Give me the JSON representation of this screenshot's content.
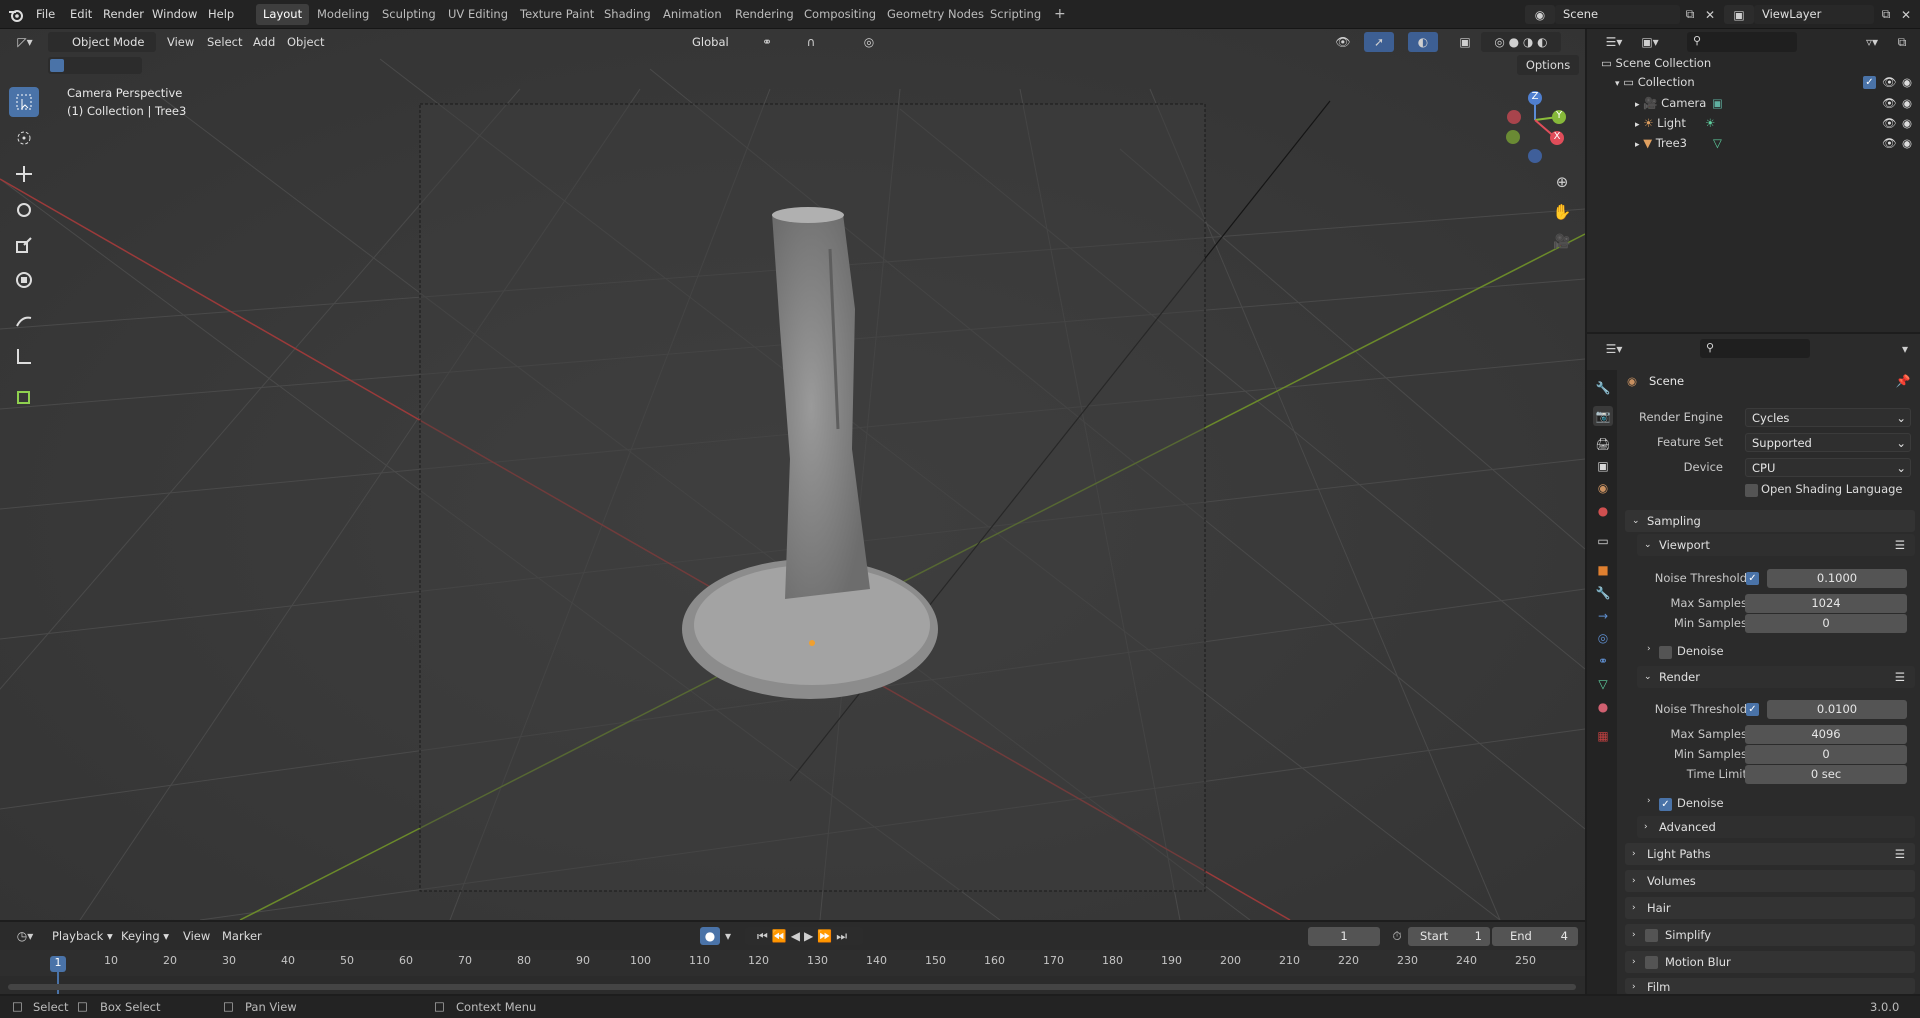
{
  "topbar": {
    "menus": [
      "File",
      "Edit",
      "Render",
      "Window",
      "Help"
    ],
    "workspaces": [
      "Layout",
      "Modeling",
      "Sculpting",
      "UV Editing",
      "Texture Paint",
      "Shading",
      "Animation",
      "Rendering",
      "Compositing",
      "Geometry Nodes",
      "Scripting"
    ],
    "active_workspace": "Layout",
    "add_tab": "+",
    "scene": "Scene",
    "view_layer": "ViewLayer"
  },
  "viewport": {
    "mode": "Object Mode",
    "menus": [
      "View",
      "Select",
      "Add",
      "Object"
    ],
    "orientation": "Global",
    "options": "Options",
    "overlay_line1": "Camera Perspective",
    "overlay_line2": "(1) Collection | Tree3",
    "gizmo": {
      "z": "Z",
      "y": "Y",
      "x": "X"
    }
  },
  "outliner": {
    "root": "Scene Collection",
    "collection": "Collection",
    "items": [
      "Camera",
      "Light",
      "Tree3"
    ]
  },
  "properties": {
    "context": "Scene",
    "render_engine_label": "Render Engine",
    "render_engine": "Cycles",
    "feature_set_label": "Feature Set",
    "feature_set": "Supported",
    "device_label": "Device",
    "device": "CPU",
    "osl_label": "Open Shading Language",
    "sampling": "Sampling",
    "viewport": {
      "title": "Viewport",
      "noise_label": "Noise Threshold",
      "noise": "0.1000",
      "max_label": "Max Samples",
      "max": "1024",
      "min_label": "Min Samples",
      "min": "0",
      "denoise": "Denoise"
    },
    "render": {
      "title": "Render",
      "noise_label": "Noise Threshold",
      "noise": "0.0100",
      "max_label": "Max Samples",
      "max": "4096",
      "min_label": "Min Samples",
      "min": "0",
      "time_label": "Time Limit",
      "time": "0 sec",
      "denoise": "Denoise"
    },
    "advanced": "Advanced",
    "panels": [
      "Light Paths",
      "Volumes",
      "Hair",
      "Simplify",
      "Motion Blur",
      "Film"
    ]
  },
  "timeline": {
    "menus": [
      "Playback",
      "Keying",
      "View",
      "Marker"
    ],
    "current_frame": "1",
    "start_label": "Start",
    "start": "1",
    "end_label": "End",
    "end": "4",
    "ticks": [
      "1",
      "10",
      "20",
      "30",
      "40",
      "50",
      "60",
      "70",
      "80",
      "90",
      "100",
      "110",
      "120",
      "130",
      "140",
      "150",
      "160",
      "170",
      "180",
      "190",
      "200",
      "210",
      "220",
      "230",
      "240",
      "250"
    ],
    "playhead": "1"
  },
  "statusbar": {
    "select": "Select",
    "box_select": "Box Select",
    "pan_view": "Pan View",
    "context_menu": "Context Menu",
    "version": "3.0.0"
  }
}
